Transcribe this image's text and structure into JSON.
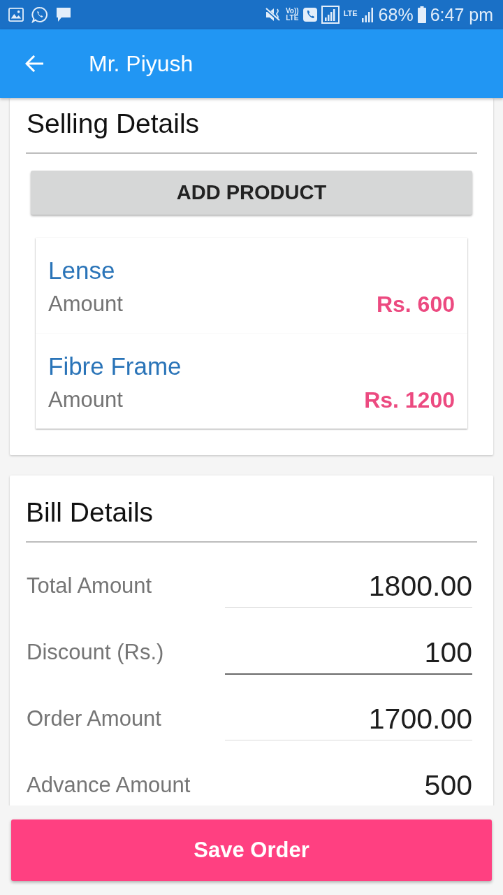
{
  "status_bar": {
    "volte_top": "Vo))",
    "volte_bottom": "LTE",
    "network": "LTE",
    "battery": "68%",
    "time": "6:47 pm"
  },
  "app_bar": {
    "title": "Mr. Piyush"
  },
  "selling_details": {
    "title": "Selling Details",
    "add_button": "ADD PRODUCT",
    "products": [
      {
        "name": "Lense",
        "amount_label": "Amount",
        "amount": "Rs. 600"
      },
      {
        "name": "Fibre Frame",
        "amount_label": "Amount",
        "amount": "Rs. 1200"
      }
    ]
  },
  "bill_details": {
    "title": "Bill Details",
    "fields": [
      {
        "label": "Total Amount",
        "value": "1800.00",
        "editable": false
      },
      {
        "label": "Discount (Rs.)",
        "value": "100",
        "editable": true
      },
      {
        "label": "Order Amount",
        "value": "1700.00",
        "editable": false
      },
      {
        "label": "Advance Amount",
        "value": "500"
      }
    ]
  },
  "save_button": "Save Order"
}
